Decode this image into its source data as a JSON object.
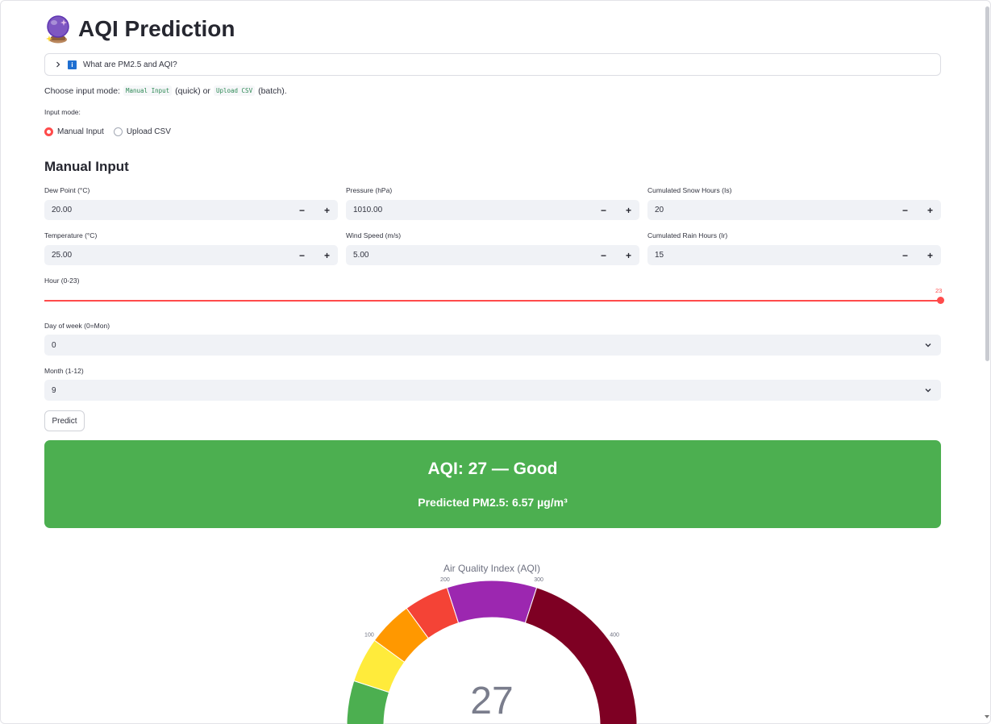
{
  "page": {
    "title": "AQI Prediction",
    "title_icon": "crystal-ball-icon"
  },
  "expander": {
    "label": "What are PM2.5 and AQI?",
    "icon": "info-icon"
  },
  "mode_text": {
    "prefix": "Choose input mode:",
    "option1": "Manual Input",
    "middle": "(quick) or",
    "option2": "Upload CSV",
    "suffix": "(batch)."
  },
  "input_mode": {
    "label": "Input mode:",
    "options": [
      "Manual Input",
      "Upload CSV"
    ],
    "selected": "Manual Input"
  },
  "manual": {
    "heading": "Manual Input",
    "fields": {
      "dew_point": {
        "label": "Dew Point (°C)",
        "value": "20.00"
      },
      "pressure": {
        "label": "Pressure (hPa)",
        "value": "1010.00"
      },
      "snow": {
        "label": "Cumulated Snow Hours (Is)",
        "value": "20"
      },
      "temperature": {
        "label": "Temperature (°C)",
        "value": "25.00"
      },
      "wind": {
        "label": "Wind Speed (m/s)",
        "value": "5.00"
      },
      "rain": {
        "label": "Cumulated Rain Hours (Ir)",
        "value": "15"
      }
    },
    "stepper_minus": "−",
    "stepper_plus": "+",
    "hour": {
      "label": "Hour (0-23)",
      "value": "23",
      "min": 0,
      "max": 23
    },
    "day_of_week": {
      "label": "Day of week (0=Mon)",
      "value": "0"
    },
    "month": {
      "label": "Month (1-12)",
      "value": "9"
    },
    "predict_label": "Predict"
  },
  "result": {
    "aqi_text": "AQI: 27 — Good",
    "pm_text": "Predicted PM2.5: 6.57 µg/m³",
    "color": "#4caf50"
  },
  "chart_data": {
    "type": "gauge",
    "title": "Air Quality Index (AQI)",
    "value": 27,
    "value_label": "27",
    "range": [
      0,
      500
    ],
    "ticks": [
      "100",
      "200",
      "300",
      "400"
    ],
    "bands": [
      {
        "from": 0,
        "to": 50,
        "color": "#4caf50"
      },
      {
        "from": 50,
        "to": 100,
        "color": "#ffeb3b"
      },
      {
        "from": 100,
        "to": 150,
        "color": "#ff9800"
      },
      {
        "from": 150,
        "to": 200,
        "color": "#f44336"
      },
      {
        "from": 200,
        "to": 300,
        "color": "#9c27b0"
      },
      {
        "from": 300,
        "to": 500,
        "color": "#7e0023"
      }
    ]
  }
}
